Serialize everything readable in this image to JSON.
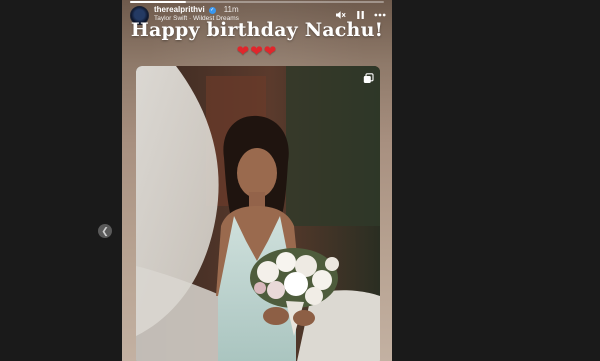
{
  "story": {
    "username": "therealprithvi",
    "time": "11m",
    "music": "Taylor Swift · Wildest Dreams",
    "caption": "Happy birthday Nachu!",
    "hearts": "❤❤❤",
    "progress": 0.22
  },
  "icons": {
    "mute": "speaker-muted-icon",
    "pause": "pause-icon",
    "more": "more-options-icon",
    "prev": "chevron-left-icon",
    "multi": "multiple-photos-icon"
  },
  "colors": {
    "heart": "#e0262b",
    "verified": "#3897f0"
  }
}
